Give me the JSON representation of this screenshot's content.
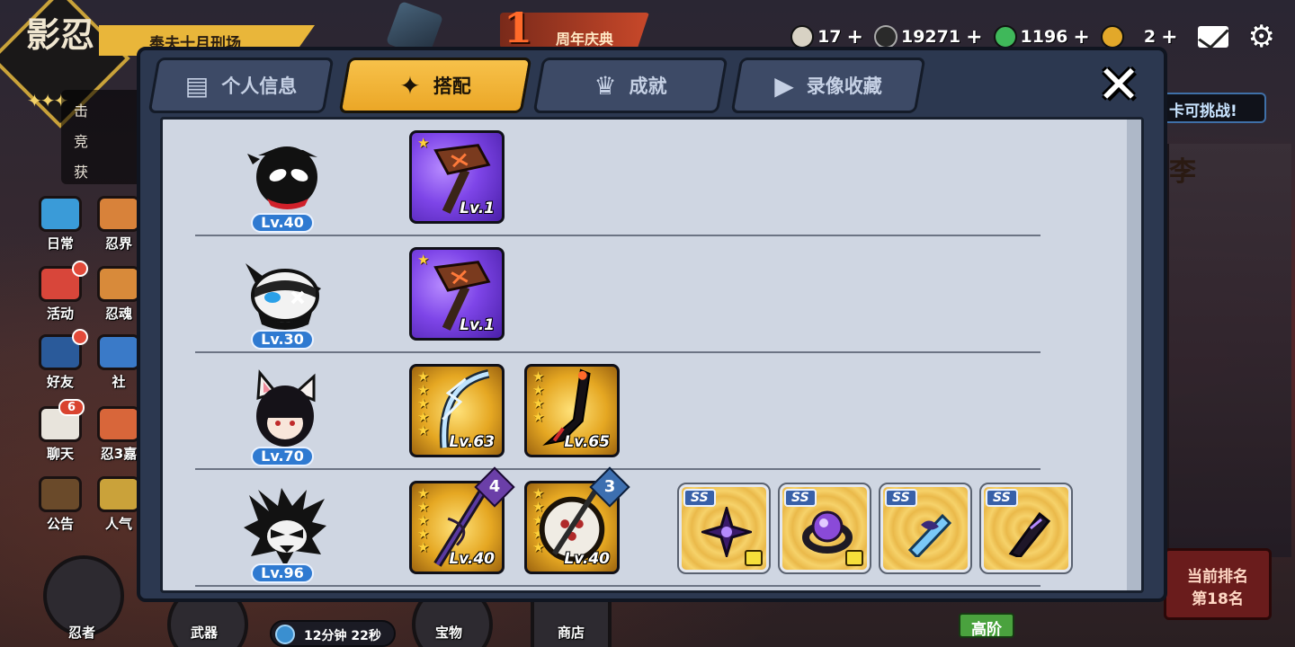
{
  "logo": {
    "text": "影忍",
    "stars": "✦✦✦"
  },
  "top_banner": "奉夫十月刑场",
  "side_bullets": [
    "击",
    "竞",
    "获"
  ],
  "event": {
    "number": "1",
    "text": "周年庆典"
  },
  "currencies": [
    {
      "icon": "riceball-icon",
      "value": "17",
      "color": "#d8d2c4"
    },
    {
      "icon": "coin-icon",
      "value": "19271",
      "color": "#2a2a2a"
    },
    {
      "icon": "jade-pin-icon",
      "value": "1196",
      "color": "#3fb85a"
    },
    {
      "icon": "gold-pin-icon",
      "value": "2",
      "color": "#e2a82a"
    }
  ],
  "currency_plus": "+",
  "left_menu": [
    {
      "label": "日常",
      "icon": "scroll-icon",
      "color": "#3a9bd8"
    },
    {
      "label": "忍界",
      "icon": "book-icon",
      "color": "#d8823a"
    },
    {
      "label": "活动",
      "icon": "torii-icon",
      "color": "#d8463a"
    },
    {
      "label": "忍魂",
      "icon": "soul-icon",
      "color": "#d88a3a"
    },
    {
      "label": "好友",
      "icon": "ninja-friend-icon",
      "color": "#2a5a9a"
    },
    {
      "label": "社",
      "icon": "community-icon",
      "color": "#3a7ac8"
    },
    {
      "label": "聊天",
      "icon": "chat-icon",
      "color": "#e8e4dc"
    },
    {
      "label": "忍3嘉",
      "icon": "event-icon",
      "color": "#d8663a"
    },
    {
      "label": "公告",
      "icon": "notice-icon",
      "color": "#6a4a2a"
    },
    {
      "label": "人气",
      "icon": "popularity-icon",
      "color": "#caa23a"
    }
  ],
  "chat_badge": "6",
  "bottom_nav": [
    {
      "label": "忍者"
    },
    {
      "label": "武器"
    },
    {
      "label": "宝物"
    },
    {
      "label": "商店"
    }
  ],
  "timer": "12分钟 22秒",
  "challenge": "卡可挑战!",
  "scroll_char": "李",
  "rank": {
    "label": "当前排名",
    "value": "第18名"
  },
  "tier_tag": "高阶",
  "tabs": [
    {
      "label": "个人信息",
      "icon": "profile-card-icon",
      "active": false
    },
    {
      "label": "搭配",
      "icon": "shuriken-icon",
      "active": true
    },
    {
      "label": "成就",
      "icon": "trophy-icon",
      "active": false
    },
    {
      "label": "录像收藏",
      "icon": "play-icon",
      "active": false
    }
  ],
  "close_label": "✕",
  "loadouts": [
    {
      "character": {
        "level": "Lv.40",
        "avatar": "black-masked-ninja-avatar"
      },
      "weapons": [
        {
          "type": "purple",
          "stars": 1,
          "level": "Lv.1",
          "icon": "hammer-icon",
          "badge": ""
        }
      ],
      "treasures": []
    },
    {
      "character": {
        "level": "Lv.30",
        "avatar": "panda-ninja-avatar"
      },
      "weapons": [
        {
          "type": "purple",
          "stars": 1,
          "level": "Lv.1",
          "icon": "hammer-icon",
          "badge": ""
        }
      ],
      "treasures": []
    },
    {
      "character": {
        "level": "Lv.70",
        "avatar": "fox-girl-avatar"
      },
      "weapons": [
        {
          "type": "gold",
          "stars": 5,
          "level": "Lv.63",
          "icon": "ice-bow-icon",
          "badge": ""
        },
        {
          "type": "gold",
          "stars": 4,
          "level": "Lv.65",
          "icon": "dark-scythe-icon",
          "badge": ""
        }
      ],
      "treasures": []
    },
    {
      "character": {
        "level": "Lv.96",
        "avatar": "wolf-ninja-avatar"
      },
      "weapons": [
        {
          "type": "gold",
          "stars": 5,
          "level": "Lv.40",
          "icon": "dark-katana-icon",
          "badge": "4"
        },
        {
          "type": "gold",
          "stars": 5,
          "level": "Lv.40",
          "icon": "war-drum-icon",
          "badge": "3"
        }
      ],
      "treasures": [
        {
          "tag": "SS",
          "icon": "shadow-shuriken-icon",
          "color": "#6a3ab0"
        },
        {
          "tag": "SS",
          "icon": "violet-ring-icon",
          "color": "#8a4ad8"
        },
        {
          "tag": "SS",
          "icon": "frost-scroll-icon",
          "color": "#4aa8e8"
        },
        {
          "tag": "SS",
          "icon": "void-blade-icon",
          "color": "#3a2a5a"
        }
      ]
    }
  ]
}
